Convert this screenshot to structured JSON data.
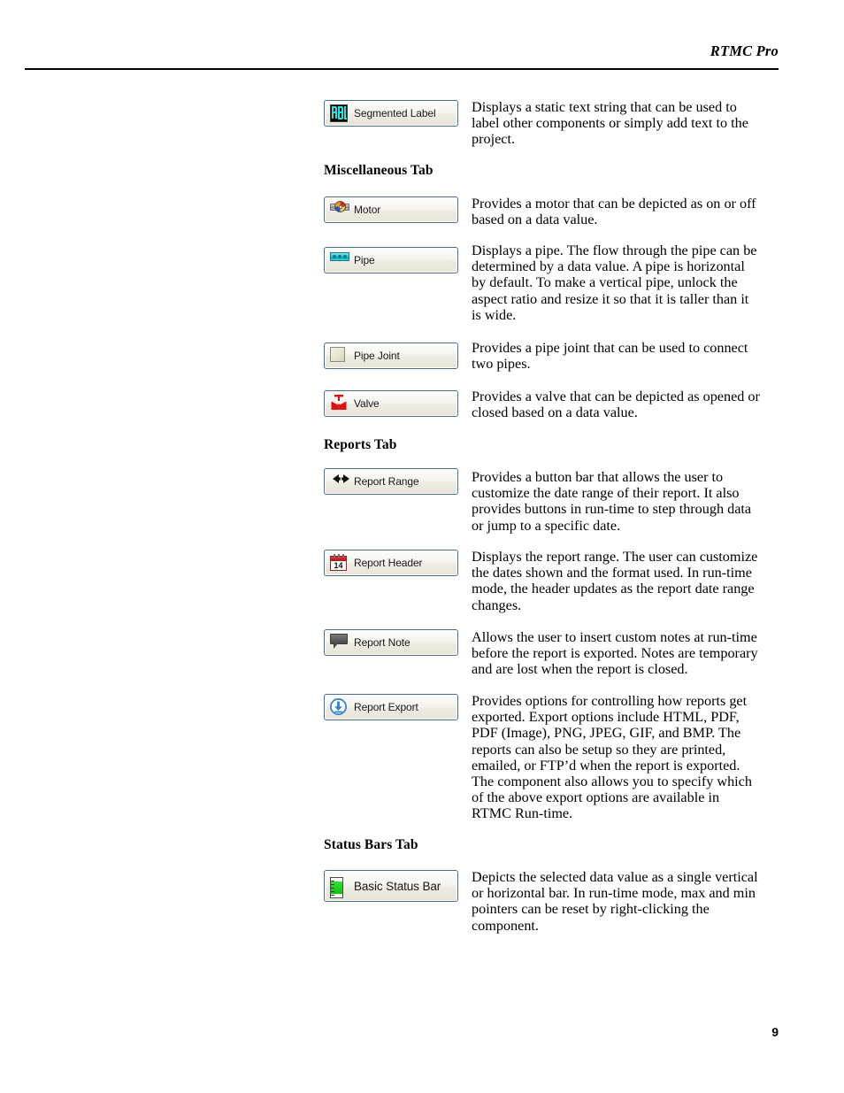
{
  "header": {
    "title": "RTMC Pro"
  },
  "footer": {
    "page_number": "9"
  },
  "sections": [
    {
      "heading": "",
      "entries": [
        {
          "label": "Segmented Label",
          "icon": "segmented-label-icon",
          "description": "Displays a static text string that can be used to label other components or simply add text to the project."
        }
      ]
    },
    {
      "heading": "Miscellaneous Tab",
      "entries": [
        {
          "label": "Motor",
          "icon": "motor-icon",
          "description": "Provides a motor that can be depicted as on or off based on a data value."
        },
        {
          "label": "Pipe",
          "icon": "pipe-icon",
          "description": "Displays a pipe.  The flow through the pipe can be determined by a data value.  A pipe is horizontal by default.  To make a vertical pipe, unlock the aspect ratio and resize it so that it is taller than it is wide."
        },
        {
          "label": "Pipe Joint",
          "icon": "pipe-joint-icon",
          "description": "Provides a pipe joint that can be used to connect two pipes."
        },
        {
          "label": "Valve",
          "icon": "valve-icon",
          "description": "Provides a valve that can be depicted as opened or closed based on a data value."
        }
      ]
    },
    {
      "heading": "Reports Tab",
      "entries": [
        {
          "label": "Report Range",
          "icon": "report-range-icon",
          "description": "Provides a button bar that allows the user to customize the date range of their report. It also provides buttons in run-time to step through data or jump to a specific date."
        },
        {
          "label": "Report Header",
          "icon": "calendar-icon",
          "icon_day": "14",
          "description": "Displays the report range. The user can customize the dates shown and the format used. In run-time mode, the header updates as the report date range changes."
        },
        {
          "label": "Report Note",
          "icon": "speech-bubble-icon",
          "description": "Allows the user to insert custom notes at run-time before the report is exported. Notes are temporary and are lost when the report is closed."
        },
        {
          "label": "Report Export",
          "icon": "download-circle-icon",
          "description": "Provides options for controlling how reports get exported. Export options include HTML, PDF, PDF (Image), PNG, JPEG, GIF, and BMP. The reports can also be setup so they are printed, emailed, or FTP’d when the report is exported. The component also allows you to specify which of the above export options are available in RTMC Run-time."
        }
      ]
    },
    {
      "heading": "Status Bars Tab",
      "entries": [
        {
          "label": "Basic Status Bar",
          "icon": "status-bar-icon",
          "description": "Depicts the selected data value as a single vertical or horizontal bar.  In run-time mode, max and min pointers can be reset by right-clicking the component."
        }
      ]
    }
  ],
  "colors": {
    "segment_cyan": "#20e5e0",
    "pipe_cyan": "#33c6d4",
    "valve_red": "#e01010",
    "calendar_red": "#c02020",
    "export_blue": "#2a7fd4",
    "status_green": "#12c812"
  }
}
